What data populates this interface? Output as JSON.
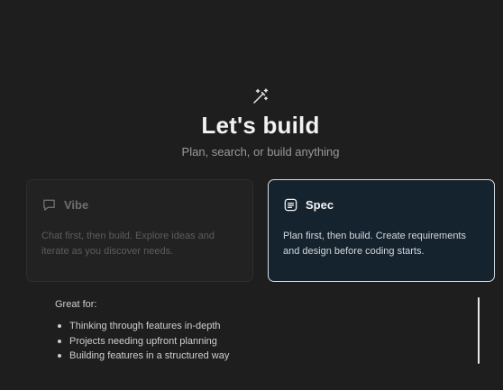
{
  "hero": {
    "icon": "magic-wand-sparkles-icon",
    "title": "Let's build",
    "subtitle": "Plan, search, or build anything"
  },
  "cards": [
    {
      "id": "vibe",
      "icon": "chat-bubble-icon",
      "title": "Vibe",
      "description": "Chat first, then build. Explore ideas and iterate as you discover needs.",
      "selected": false
    },
    {
      "id": "spec",
      "icon": "document-lines-icon",
      "title": "Spec",
      "description": "Plan first, then build. Create requirements and design before coding starts.",
      "selected": true
    }
  ],
  "details": {
    "heading": "Great for:",
    "items": [
      "Thinking through features in-depth",
      "Projects needing upfront planning",
      "Building features in a structured way"
    ]
  },
  "colors": {
    "background": "#1e1e1e",
    "selected_card_bg": "#15232e",
    "selected_card_border": "#d6dde3"
  }
}
